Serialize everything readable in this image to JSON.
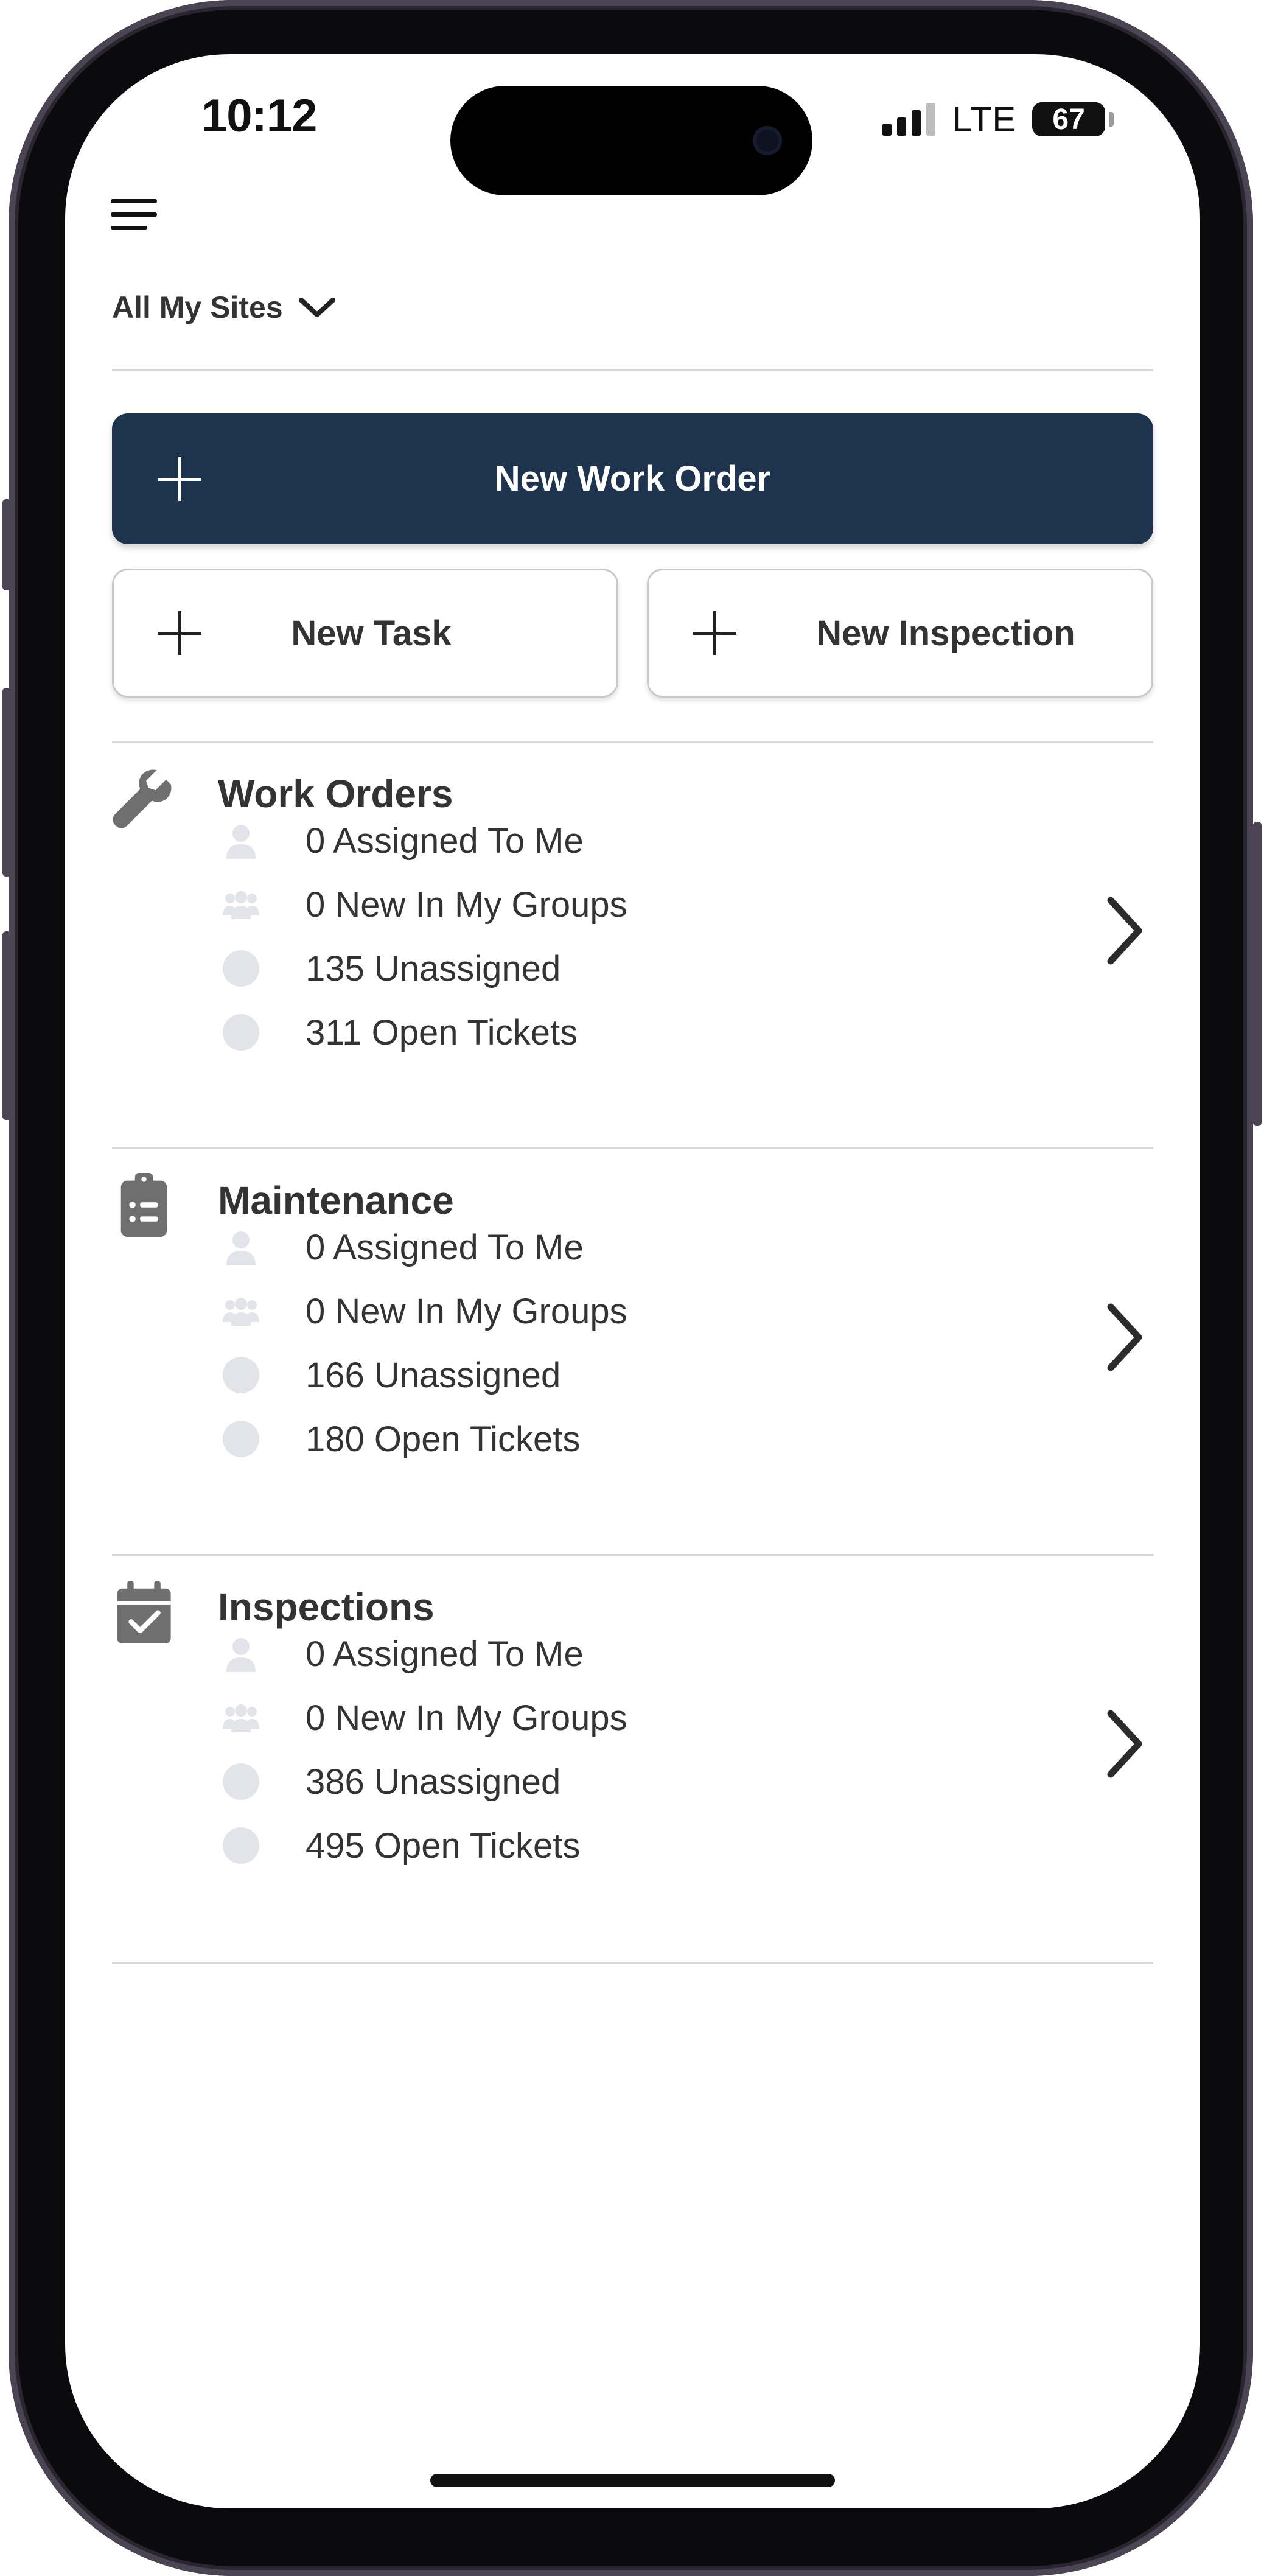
{
  "status_bar": {
    "time": "10:12",
    "network": "LTE",
    "battery": "67"
  },
  "header": {
    "site_selector": "All My Sites"
  },
  "actions": {
    "new_work_order": "New Work Order",
    "new_task": "New Task",
    "new_inspection": "New Inspection"
  },
  "sections": [
    {
      "title": "Work Orders",
      "icon": "wrench-icon",
      "stats": [
        {
          "text": "0 Assigned To Me",
          "icon": "person-icon"
        },
        {
          "text": "0 New In My Groups",
          "icon": "group-icon"
        },
        {
          "text": "135 Unassigned",
          "icon": "circle-icon"
        },
        {
          "text": "311 Open Tickets",
          "icon": "circle-icon"
        }
      ]
    },
    {
      "title": "Maintenance",
      "icon": "clipboard-list-icon",
      "stats": [
        {
          "text": "0 Assigned To Me",
          "icon": "person-icon"
        },
        {
          "text": "0 New In My Groups",
          "icon": "group-icon"
        },
        {
          "text": "166 Unassigned",
          "icon": "circle-icon"
        },
        {
          "text": "180 Open Tickets",
          "icon": "circle-icon"
        }
      ]
    },
    {
      "title": "Inspections",
      "icon": "calendar-check-icon",
      "stats": [
        {
          "text": "0 Assigned To Me",
          "icon": "person-icon"
        },
        {
          "text": "0 New In My Groups",
          "icon": "group-icon"
        },
        {
          "text": "386 Unassigned",
          "icon": "circle-icon"
        },
        {
          "text": "495 Open Tickets",
          "icon": "circle-icon"
        }
      ]
    }
  ],
  "colors": {
    "primary": "#1e334d",
    "text": "#333333",
    "icon_gray": "#6f6f6f",
    "stat_icon": "#e2e4e9",
    "divider": "#d9d9d9"
  }
}
